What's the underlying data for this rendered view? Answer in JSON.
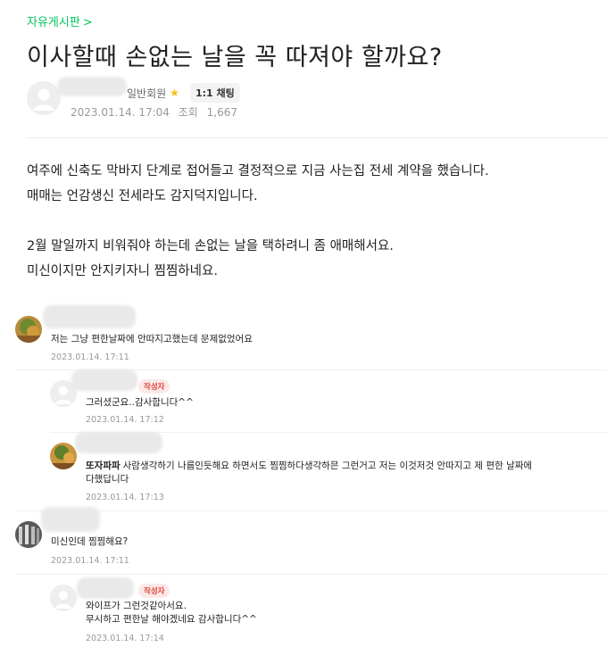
{
  "board": {
    "label": "자유게시판",
    "chevron": ">"
  },
  "post": {
    "title": "이사할때 손없는 날을 꼭 따져야 할까요?",
    "author_grade": "일반회원",
    "chat_button": "1:1 채팅",
    "date": "2023.01.14. 17:04",
    "views_label": "조회",
    "views": "1,667",
    "body": [
      "여주에 신축도 막바지 단계로 접어들고 결정적으로 지금 사는집 전세 계약을 했습니다.",
      "매매는 언감생신 전세라도 감지덕지입니다.",
      "",
      "2월 말일까지 비워줘야 하는데 손없는 날을 택하려니 좀 애매해서요.",
      "미신이지만 안지키자니 찜찜하네요."
    ]
  },
  "comments": [
    {
      "text": "저는 그냥 편한날짜에 안따지고했는데 문제없었어요",
      "date": "2023.01.14. 17:11"
    },
    {
      "badge": "작성자",
      "text": "그러셨군요..감사합니다^^",
      "date": "2023.01.14. 17:12"
    },
    {
      "nick": "또자파파",
      "text": "사람생각하기 나름인듯해요 하면서도 찜찜하다생각하믄 그런거고 저는 이것저것 안따지고 제 편한 날짜에",
      "text2": "다했답니다",
      "date": "2023.01.14. 17:13"
    },
    {
      "text": "미신인데 찜찜해요?",
      "date": "2023.01.14. 17:11"
    },
    {
      "badge": "작성자",
      "text": "와이프가 그런것같아서요.",
      "text2": "무시하고 편한날 해야겠네요 감사합니다^^",
      "date": "2023.01.14. 17:14"
    }
  ],
  "colors": {
    "accent": "#03c75a",
    "badge_text": "#e0483d",
    "meta": "#999999",
    "star": "#f4c21a"
  },
  "icons": {
    "chevron": "chevron-right-icon",
    "star": "star-icon",
    "avatar": "default-avatar-icon"
  }
}
